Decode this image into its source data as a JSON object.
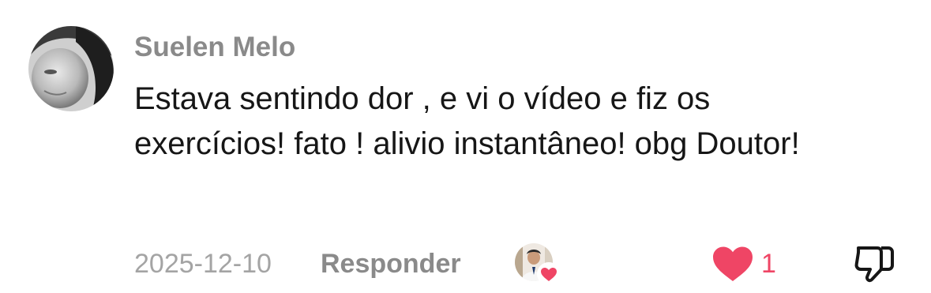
{
  "comment": {
    "username": "Suelen Melo",
    "text": "Estava sentindo dor , e vi o vídeo e fiz os exercícios! fato ! alivio instantâneo! obg Doutor!",
    "date": "2025-12-10",
    "reply_label": "Responder",
    "like_count": "1",
    "liked_by_creator": true,
    "colors": {
      "username": "#8a8a8a",
      "text": "#161616",
      "date": "#a4a4a4",
      "like": "#ef4565"
    },
    "icons": {
      "avatar": "user-avatar",
      "creator_avatar": "creator-avatar",
      "creator_heart": "heart-icon",
      "like": "heart-icon",
      "dislike": "thumbs-down-icon"
    }
  }
}
